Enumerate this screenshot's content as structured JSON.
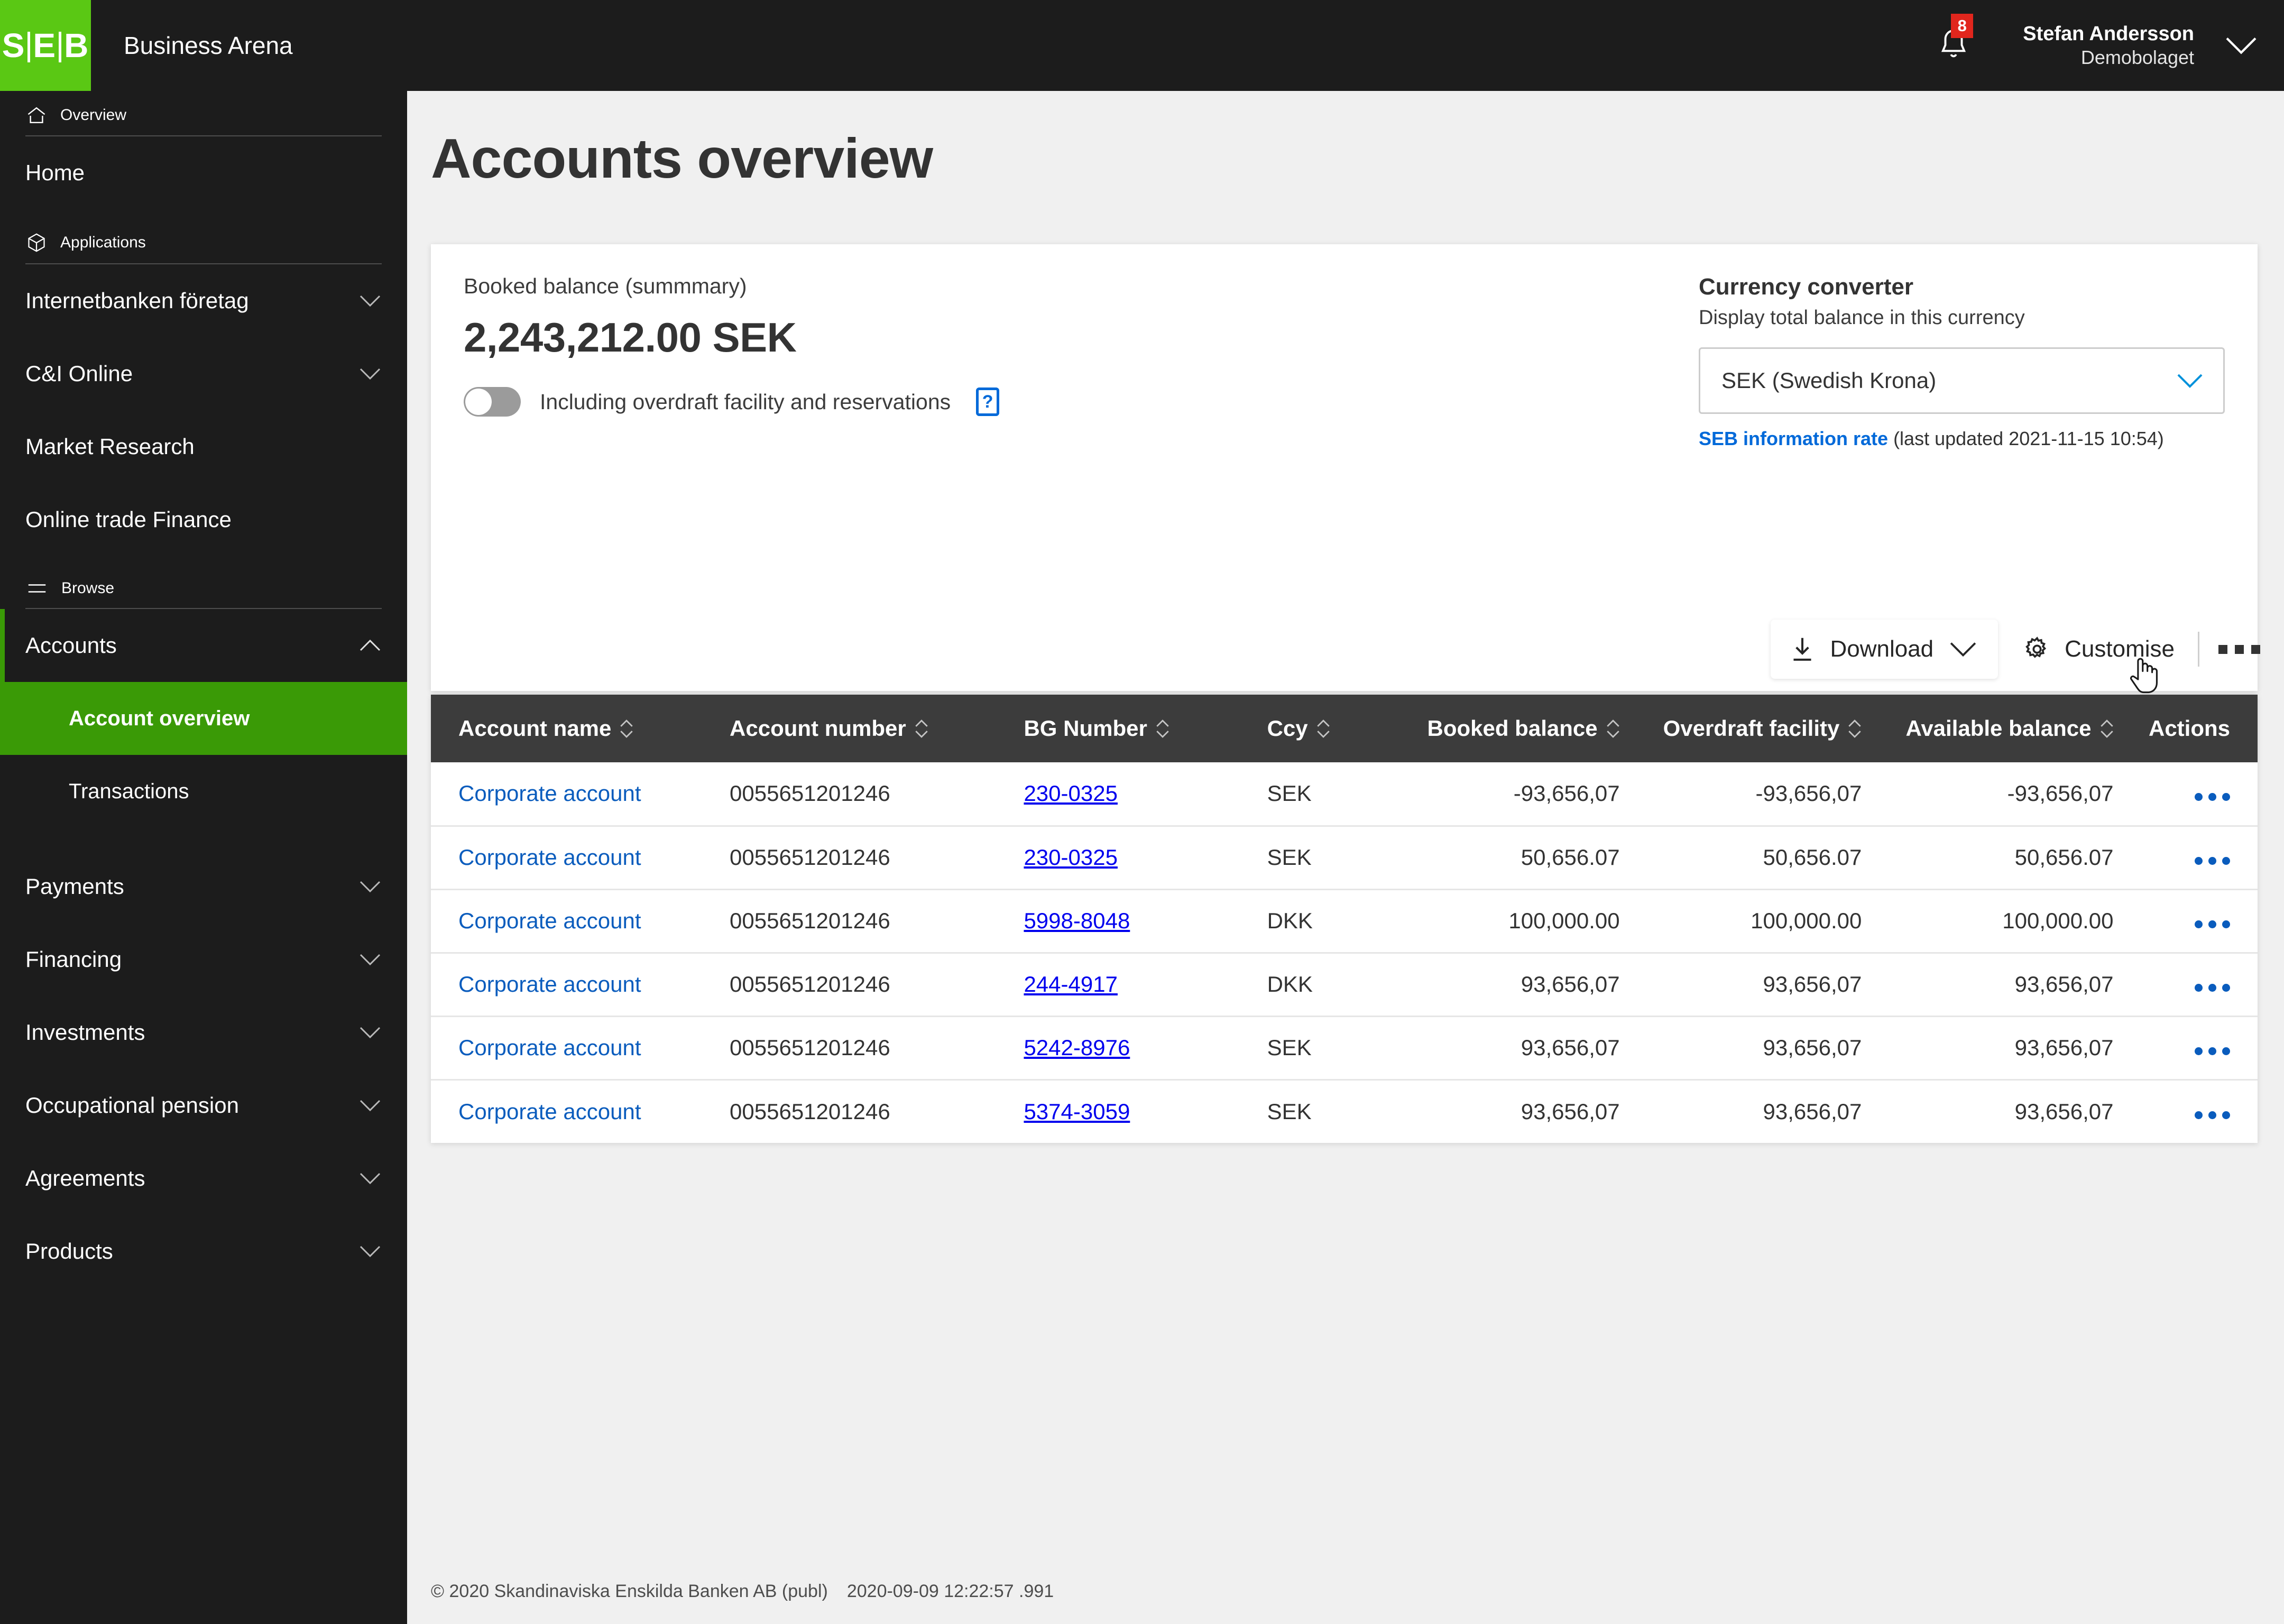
{
  "topbar": {
    "logo_s": "S",
    "logo_e": "E",
    "logo_b": "B",
    "brand_title": "Business Arena",
    "notification_count": "8",
    "user_name": "Stefan Andersson",
    "user_org": "Demobolaget",
    "logo_bg_color": "#5ac814",
    "badge_color": "#e1261d"
  },
  "sidebar": {
    "overview_label": "Overview",
    "home_label": "Home",
    "applications_label": "Applications",
    "apps": [
      {
        "label": "Internetbanken företag",
        "expandable": true
      },
      {
        "label": "C&I Online",
        "expandable": true
      },
      {
        "label": "Market Research",
        "expandable": false
      },
      {
        "label": "Online trade Finance",
        "expandable": false
      }
    ],
    "browse_label": "Browse",
    "accounts_label": "Accounts",
    "accounts_children": [
      {
        "label": "Account overview",
        "active": true
      },
      {
        "label": "Transactions",
        "active": false
      }
    ],
    "sections": [
      {
        "label": "Payments"
      },
      {
        "label": "Financing"
      },
      {
        "label": "Investments"
      },
      {
        "label": "Occupational pension"
      },
      {
        "label": "Agreements"
      },
      {
        "label": "Products"
      }
    ],
    "active_color": "#3a9a06"
  },
  "main": {
    "page_title": "Accounts overview",
    "booked_label": "Booked balance (summmary)",
    "booked_amount": "2,243,212.00 SEK",
    "toggle_label": "Including overdraft facility and reservations",
    "toggle_on": false,
    "help_glyph": "?"
  },
  "converter": {
    "title": "Currency converter",
    "subtitle": "Display total balance in this currency",
    "selected": "SEK (Swedish Krona)",
    "link_text": "SEB information rate",
    "note_suffix": " (last updated 2021-11-15 10:54)",
    "link_color": "#0069d9"
  },
  "toolbar": {
    "download_label": "Download",
    "customise_label": "Customise",
    "more_label": "More options"
  },
  "table": {
    "columns": [
      {
        "label": "Account name",
        "sortable": true,
        "align": "left"
      },
      {
        "label": "Account number",
        "sortable": true,
        "align": "left"
      },
      {
        "label": "BG Number",
        "sortable": true,
        "align": "left"
      },
      {
        "label": "Ccy",
        "sortable": true,
        "align": "left"
      },
      {
        "label": "Booked balance",
        "sortable": true,
        "align": "right"
      },
      {
        "label": "Overdraft facility",
        "sortable": true,
        "align": "right"
      },
      {
        "label": "Available balance",
        "sortable": true,
        "align": "right"
      },
      {
        "label": "Actions",
        "sortable": false,
        "align": "right"
      }
    ],
    "rows": [
      {
        "name": "Corporate account",
        "number": "0055651201246",
        "bg": "230-0325",
        "ccy": "SEK",
        "booked": "-93,656,07",
        "overdraft": "-93,656,07",
        "available": "-93,656,07"
      },
      {
        "name": "Corporate account",
        "number": "0055651201246",
        "bg": "230-0325",
        "ccy": "SEK",
        "booked": "50,656.07",
        "overdraft": "50,656.07",
        "available": "50,656.07"
      },
      {
        "name": "Corporate account",
        "number": "0055651201246",
        "bg": "5998-8048",
        "ccy": "DKK",
        "booked": "100,000.00",
        "overdraft": "100,000.00",
        "available": "100,000.00"
      },
      {
        "name": "Corporate account",
        "number": "0055651201246",
        "bg": "244-4917",
        "ccy": "DKK",
        "booked": "93,656,07",
        "overdraft": "93,656,07",
        "available": "93,656,07"
      },
      {
        "name": "Corporate account",
        "number": "0055651201246",
        "bg": "5242-8976",
        "ccy": "SEK",
        "booked": "93,656,07",
        "overdraft": "93,656,07",
        "available": "93,656,07"
      },
      {
        "name": "Corporate account",
        "number": "0055651201246",
        "bg": "5374-3059",
        "ccy": "SEK",
        "booked": "93,656,07",
        "overdraft": "93,656,07",
        "available": "93,656,07"
      }
    ]
  },
  "footer": {
    "copyright": "© 2020 Skandinaviska Enskilda Banken AB (publ)",
    "timestamp": "2020-09-09 12:22:57 .991"
  }
}
